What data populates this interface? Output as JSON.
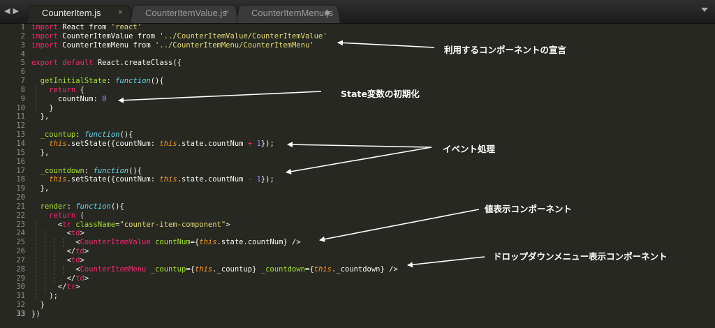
{
  "tabs": [
    {
      "label": "CounterItem.js",
      "active": true,
      "button": "×"
    },
    {
      "label": "CounterItemValue.js",
      "active": false,
      "button": "×"
    },
    {
      "label": "CounterItemMenu.js",
      "active": false,
      "modified": true
    }
  ],
  "nav": {
    "back": "◀",
    "forward": "▶"
  },
  "current_line": 33,
  "code_lines": [
    [
      [
        "kw",
        "import"
      ],
      [
        "pl",
        " React from "
      ],
      [
        "str",
        "'react'"
      ]
    ],
    [
      [
        "kw",
        "import"
      ],
      [
        "pl",
        " CounterItemValue from "
      ],
      [
        "str",
        "'../CounterItemValue/CounterItemValue'"
      ]
    ],
    [
      [
        "kw",
        "import"
      ],
      [
        "pl",
        " CounterItemMenu from "
      ],
      [
        "str",
        "'../CounterItemMenu/CounterItemMenu'"
      ]
    ],
    [],
    [
      [
        "kw",
        "export default"
      ],
      [
        "pl",
        " React.createClass({"
      ]
    ],
    [],
    [
      [
        "pl",
        "  "
      ],
      [
        "fn",
        "getInitialState"
      ],
      [
        "pl",
        ": "
      ],
      [
        "st",
        "function"
      ],
      [
        "pl",
        "(){"
      ]
    ],
    [
      [
        "pl",
        "    "
      ],
      [
        "kw",
        "return"
      ],
      [
        "pl",
        " {"
      ]
    ],
    [
      [
        "pl",
        "      countNum: "
      ],
      [
        "num",
        "0"
      ]
    ],
    [
      [
        "pl",
        "    }"
      ]
    ],
    [
      [
        "pl",
        "  },"
      ]
    ],
    [],
    [
      [
        "pl",
        "  "
      ],
      [
        "fn",
        "_countup"
      ],
      [
        "pl",
        ": "
      ],
      [
        "st",
        "function"
      ],
      [
        "pl",
        "(){"
      ]
    ],
    [
      [
        "pl",
        "    "
      ],
      [
        "this",
        "this"
      ],
      [
        "pl",
        ".setState({countNum: "
      ],
      [
        "this",
        "this"
      ],
      [
        "pl",
        ".state.countNum "
      ],
      [
        "kw",
        "+"
      ],
      [
        "pl",
        " "
      ],
      [
        "num",
        "1"
      ],
      [
        "pl",
        "});"
      ]
    ],
    [
      [
        "pl",
        "  },"
      ]
    ],
    [],
    [
      [
        "pl",
        "  "
      ],
      [
        "fn",
        "_countdown"
      ],
      [
        "pl",
        ": "
      ],
      [
        "st",
        "function"
      ],
      [
        "pl",
        "(){"
      ]
    ],
    [
      [
        "pl",
        "    "
      ],
      [
        "this",
        "this"
      ],
      [
        "pl",
        ".setState({countNum: "
      ],
      [
        "this",
        "this"
      ],
      [
        "pl",
        ".state.countNum "
      ],
      [
        "kw",
        "-"
      ],
      [
        "pl",
        " "
      ],
      [
        "num",
        "1"
      ],
      [
        "pl",
        "});"
      ]
    ],
    [
      [
        "pl",
        "  },"
      ]
    ],
    [],
    [
      [
        "pl",
        "  "
      ],
      [
        "fn",
        "render"
      ],
      [
        "pl",
        ": "
      ],
      [
        "st",
        "function"
      ],
      [
        "pl",
        "(){"
      ]
    ],
    [
      [
        "pl",
        "    "
      ],
      [
        "kw",
        "return"
      ],
      [
        "pl",
        " ("
      ]
    ],
    [
      [
        "pl",
        "      <"
      ],
      [
        "tg",
        "tr"
      ],
      [
        "pl",
        " "
      ],
      [
        "at",
        "className"
      ],
      [
        "pl",
        "="
      ],
      [
        "str",
        "\"counter-item-component\""
      ],
      [
        "pl",
        ">"
      ]
    ],
    [
      [
        "pl",
        "        <"
      ],
      [
        "tg",
        "td"
      ],
      [
        "pl",
        ">"
      ]
    ],
    [
      [
        "pl",
        "          <"
      ],
      [
        "tg",
        "CounterItemValue"
      ],
      [
        "pl",
        " "
      ],
      [
        "at",
        "countNum"
      ],
      [
        "pl",
        "={"
      ],
      [
        "this",
        "this"
      ],
      [
        "pl",
        ".state.countNum} />"
      ]
    ],
    [
      [
        "pl",
        "        </"
      ],
      [
        "tg",
        "td"
      ],
      [
        "pl",
        ">"
      ]
    ],
    [
      [
        "pl",
        "        <"
      ],
      [
        "tg",
        "td"
      ],
      [
        "pl",
        ">"
      ]
    ],
    [
      [
        "pl",
        "          <"
      ],
      [
        "tg",
        "CounterItemMenu"
      ],
      [
        "pl",
        " "
      ],
      [
        "at",
        "_countup"
      ],
      [
        "pl",
        "={"
      ],
      [
        "this",
        "this"
      ],
      [
        "pl",
        "._countup} "
      ],
      [
        "at",
        "_countdown"
      ],
      [
        "pl",
        "={"
      ],
      [
        "this",
        "this"
      ],
      [
        "pl",
        "._countdown} />"
      ]
    ],
    [
      [
        "pl",
        "        </"
      ],
      [
        "tg",
        "td"
      ],
      [
        "pl",
        ">"
      ]
    ],
    [
      [
        "pl",
        "      </"
      ],
      [
        "tg",
        "tr"
      ],
      [
        "pl",
        ">"
      ]
    ],
    [
      [
        "pl",
        "    );"
      ]
    ],
    [
      [
        "pl",
        "  }"
      ]
    ],
    [
      [
        "pl",
        "})"
      ]
    ]
  ],
  "annotations": [
    {
      "label": "利用するコンポーネントの宣言"
    },
    {
      "label": "State変数の初期化"
    },
    {
      "label": "イベント処理"
    },
    {
      "label": "値表示コンポーネント"
    },
    {
      "label": "ドロップダウンメニュー表示コンポーネント"
    }
  ],
  "colors": {
    "background": "#272822",
    "keyword": "#f92672",
    "string": "#e6db74",
    "function_name": "#a6e22e",
    "storage": "#66d9ef",
    "this": "#fd971f",
    "number": "#ae81ff",
    "annotation": "#ffffff"
  }
}
